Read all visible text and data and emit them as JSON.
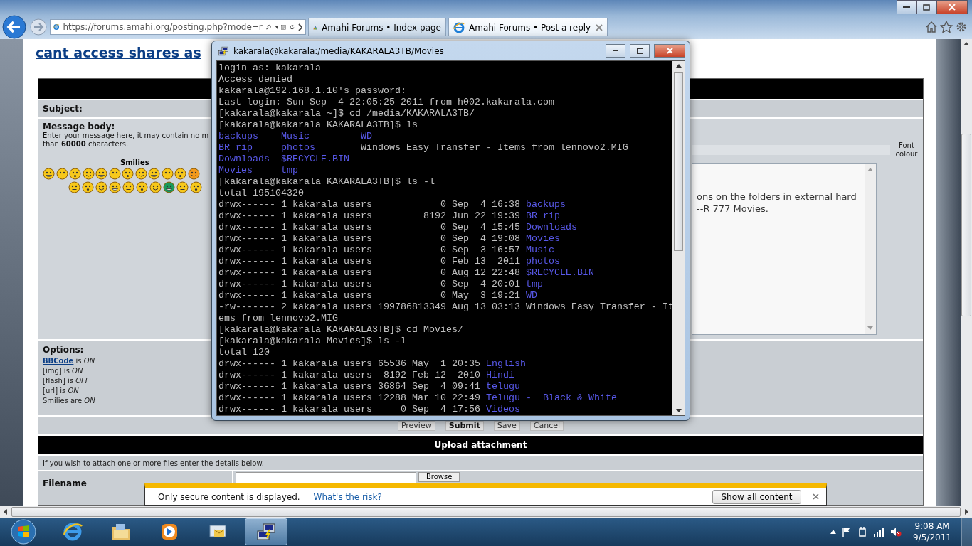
{
  "browser": {
    "address": "https://forums.amahi.org/posting.php?mode=r",
    "tabs": [
      {
        "label": "Amahi Forums • Index page",
        "selected": false,
        "closable": false
      },
      {
        "label": "Amahi Forums • Post a reply",
        "selected": true,
        "closable": true
      }
    ]
  },
  "page": {
    "title": "cant access shares as",
    "subject_label": "Subject:",
    "body_label": "Message body:",
    "body_hint": [
      "Enter your message here, it may contain no m",
      "than **60000** characters."
    ],
    "smilies_title": "Smilies",
    "font_colour": "Font colour",
    "message_lines": [
      "ons on the folders in external hard",
      "--R 777 Movies."
    ],
    "options_label": "Options:",
    "options": [
      {
        "link": "BBCode",
        "text": "is *ON*"
      },
      {
        "text": "[img] is *ON*"
      },
      {
        "text": "[flash] is *OFF*"
      },
      {
        "text": "[url] is *ON*"
      },
      {
        "text": "Smilies are *ON*"
      }
    ],
    "buttons": [
      {
        "label": "Preview",
        "primary": false
      },
      {
        "label": "Submit",
        "primary": true
      },
      {
        "label": "Save",
        "primary": false
      },
      {
        "label": "Cancel",
        "primary": false
      }
    ],
    "upload_title": "Upload attachment",
    "upload_hint": "If you wish to attach one or more files enter the details below.",
    "filename_label": "Filename",
    "browse": "Browse"
  },
  "terminal": {
    "title": "kakarala@kakarala:/media/KAKARALA3TB/Movies",
    "lines": [
      {
        "kind": "text",
        "text": "login as: kakarala"
      },
      {
        "kind": "text",
        "text": "Access denied"
      },
      {
        "kind": "text",
        "text": "kakarala@192.168.1.10's password:"
      },
      {
        "kind": "text",
        "text": "Last login: Sun Sep  4 22:05:25 2011 from h002.kakarala.com"
      },
      {
        "kind": "text",
        "text": "[kakarala@kakarala ~]$ cd /media/KAKARALA3TB/"
      },
      {
        "kind": "text",
        "text": "[kakarala@kakarala KAKARALA3TB]$ ls"
      },
      {
        "kind": "ls",
        "cells": [
          {
            "text": "backups",
            "dir": true
          },
          {
            "text": "Music",
            "dir": true
          },
          {
            "text": "WD",
            "dir": true
          }
        ]
      },
      {
        "kind": "ls",
        "cells": [
          {
            "text": "BR rip",
            "dir": true
          },
          {
            "text": "photos",
            "dir": true
          },
          {
            "text": "Windows Easy Transfer - Items from lennovo2.MIG",
            "dir": false
          }
        ]
      },
      {
        "kind": "ls",
        "cells": [
          {
            "text": "Downloads",
            "dir": true
          },
          {
            "text": "$RECYCLE.BIN",
            "dir": true
          }
        ]
      },
      {
        "kind": "ls",
        "cells": [
          {
            "text": "Movies",
            "dir": true
          },
          {
            "text": "tmp",
            "dir": true
          }
        ]
      },
      {
        "kind": "text",
        "text": "[kakarala@kakarala KAKARALA3TB]$ ls -l"
      },
      {
        "kind": "text",
        "text": "total 195104320"
      },
      {
        "kind": "long",
        "meta": "drwx------ 1 kakarala users            0 Sep  4 16:38",
        "name": "backups",
        "dir": true
      },
      {
        "kind": "long",
        "meta": "drwx------ 1 kakarala users         8192 Jun 22 19:39",
        "name": "BR rip",
        "dir": true
      },
      {
        "kind": "long",
        "meta": "drwx------ 1 kakarala users            0 Sep  4 15:45",
        "name": "Downloads",
        "dir": true
      },
      {
        "kind": "long",
        "meta": "drwx------ 1 kakarala users            0 Sep  4 19:08",
        "name": "Movies",
        "dir": true
      },
      {
        "kind": "long",
        "meta": "drwx------ 1 kakarala users            0 Sep  3 16:57",
        "name": "Music",
        "dir": true
      },
      {
        "kind": "long",
        "meta": "drwx------ 1 kakarala users            0 Feb 13  2011",
        "name": "photos",
        "dir": true
      },
      {
        "kind": "long",
        "meta": "drwx------ 1 kakarala users            0 Aug 12 22:48",
        "name": "$RECYCLE.BIN",
        "dir": true
      },
      {
        "kind": "long",
        "meta": "drwx------ 1 kakarala users            0 Sep  4 20:01",
        "name": "tmp",
        "dir": true
      },
      {
        "kind": "long",
        "meta": "drwx------ 1 kakarala users            0 May  3 19:21",
        "name": "WD",
        "dir": true
      },
      {
        "kind": "long",
        "meta": "-rw------- 2 kakarala users 199786813349 Aug 13 03:13",
        "name": "Windows Easy Transfer - Items from lennovo2.MIG",
        "dir": false
      },
      {
        "kind": "text",
        "text": "[kakarala@kakarala KAKARALA3TB]$ cd Movies/"
      },
      {
        "kind": "text",
        "text": "[kakarala@kakarala Movies]$ ls -l"
      },
      {
        "kind": "text",
        "text": "total 120"
      },
      {
        "kind": "long",
        "meta": "drwx------ 1 kakarala users 65536 May  1 20:35",
        "name": "English",
        "dir": true
      },
      {
        "kind": "long",
        "meta": "drwx------ 1 kakarala users  8192 Feb 12  2010",
        "name": "Hindi",
        "dir": true
      },
      {
        "kind": "long",
        "meta": "drwx------ 1 kakarala users 36864 Sep  4 09:41",
        "name": "telugu",
        "dir": true
      },
      {
        "kind": "long",
        "meta": "drwx------ 1 kakarala users 12288 Mar 10 22:49",
        "name": "Telugu -  Black & White",
        "dir": true
      },
      {
        "kind": "long",
        "meta": "drwx------ 1 kakarala users     0 Sep  4 17:56",
        "name": "Videos",
        "dir": true
      }
    ]
  },
  "notification": {
    "message": "Only secure content is displayed.",
    "link": "What's the risk?",
    "button": "Show all content"
  },
  "taskbar": {
    "apps": [
      {
        "kind": "ie",
        "active": false
      },
      {
        "kind": "folder",
        "active": false
      },
      {
        "kind": "media",
        "active": false
      },
      {
        "kind": "mail",
        "active": false
      },
      {
        "kind": "terminal",
        "active": true
      }
    ],
    "time": "9:08 AM",
    "date": "9/5/2011"
  }
}
